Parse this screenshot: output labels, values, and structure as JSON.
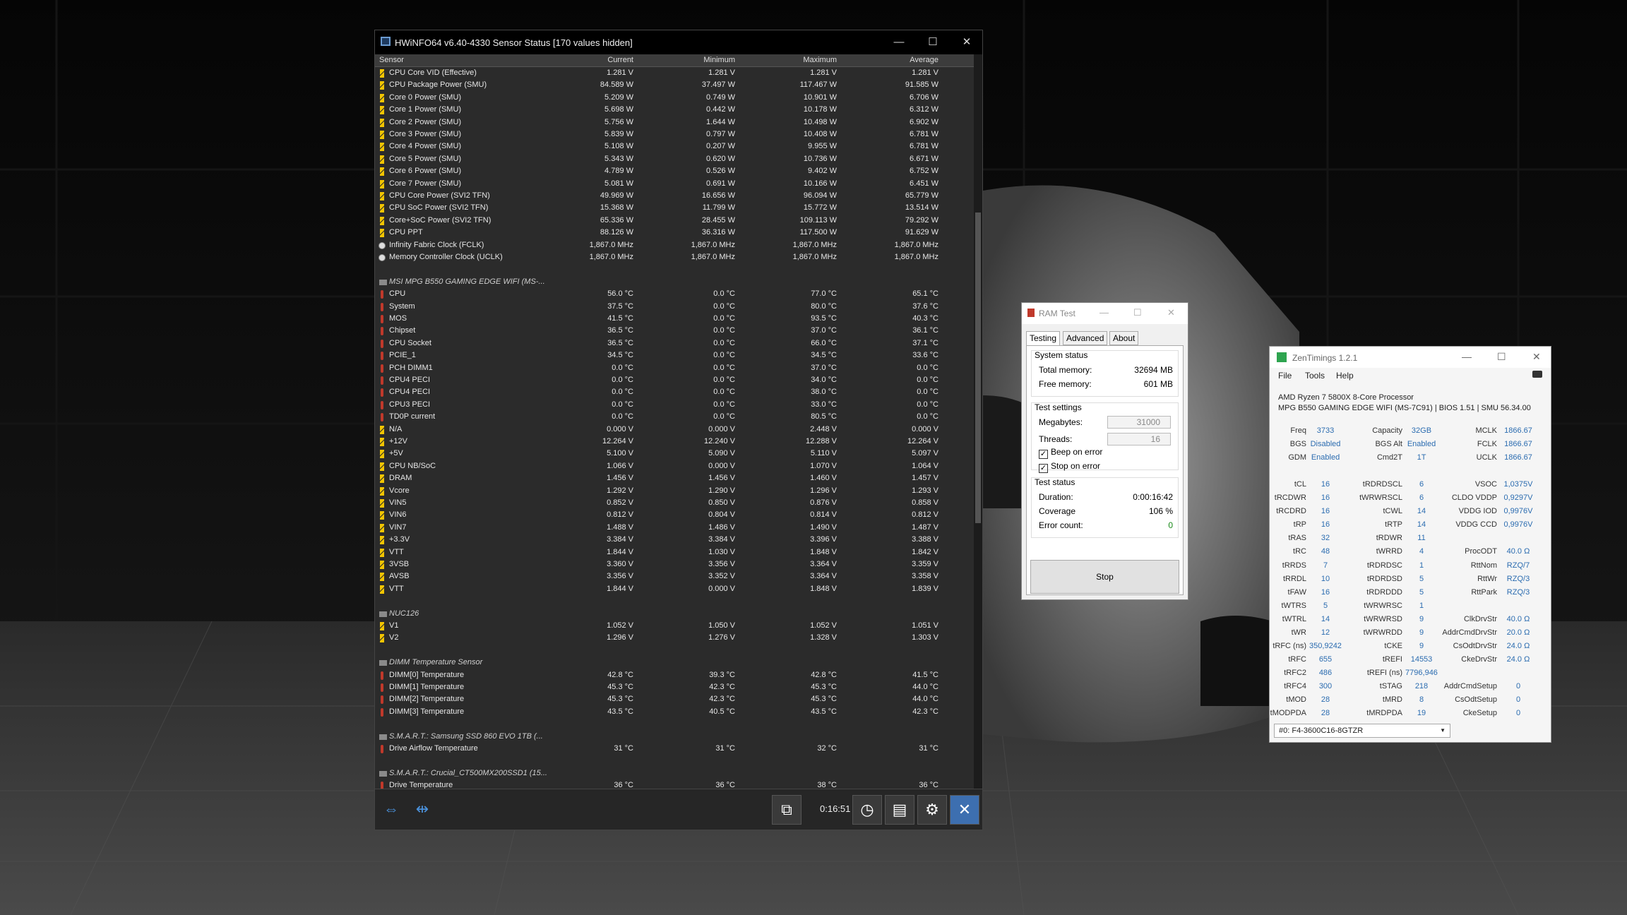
{
  "hwinfo": {
    "title": "HWiNFO64 v6.40-4330 Sensor Status [170 values hidden]",
    "columns": {
      "sensor": "Sensor",
      "current": "Current",
      "minimum": "Minimum",
      "maximum": "Maximum",
      "average": "Average"
    },
    "rows": [
      {
        "icon": "pw",
        "name": "CPU Core VID (Effective)",
        "cur": "1.281 V",
        "min": "1.281 V",
        "max": "1.281 V",
        "avg": "1.281 V"
      },
      {
        "icon": "pw",
        "name": "CPU Package Power (SMU)",
        "cur": "84.589 W",
        "min": "37.497 W",
        "max": "117.467 W",
        "avg": "91.585 W"
      },
      {
        "icon": "pw",
        "name": "Core 0 Power (SMU)",
        "cur": "5.209 W",
        "min": "0.749 W",
        "max": "10.901 W",
        "avg": "6.706 W"
      },
      {
        "icon": "pw",
        "name": "Core 1 Power (SMU)",
        "cur": "5.698 W",
        "min": "0.442 W",
        "max": "10.178 W",
        "avg": "6.312 W"
      },
      {
        "icon": "pw",
        "name": "Core 2 Power (SMU)",
        "cur": "5.756 W",
        "min": "1.644 W",
        "max": "10.498 W",
        "avg": "6.902 W"
      },
      {
        "icon": "pw",
        "name": "Core 3 Power (SMU)",
        "cur": "5.839 W",
        "min": "0.797 W",
        "max": "10.408 W",
        "avg": "6.781 W"
      },
      {
        "icon": "pw",
        "name": "Core 4 Power (SMU)",
        "cur": "5.108 W",
        "min": "0.207 W",
        "max": "9.955 W",
        "avg": "6.781 W"
      },
      {
        "icon": "pw",
        "name": "Core 5 Power (SMU)",
        "cur": "5.343 W",
        "min": "0.620 W",
        "max": "10.736 W",
        "avg": "6.671 W"
      },
      {
        "icon": "pw",
        "name": "Core 6 Power (SMU)",
        "cur": "4.789 W",
        "min": "0.526 W",
        "max": "9.402 W",
        "avg": "6.752 W"
      },
      {
        "icon": "pw",
        "name": "Core 7 Power (SMU)",
        "cur": "5.081 W",
        "min": "0.691 W",
        "max": "10.166 W",
        "avg": "6.451 W"
      },
      {
        "icon": "pw",
        "name": "CPU Core Power (SVI2 TFN)",
        "cur": "49.969 W",
        "min": "16.656 W",
        "max": "96.094 W",
        "avg": "65.779 W"
      },
      {
        "icon": "pw",
        "name": "CPU SoC Power (SVI2 TFN)",
        "cur": "15.368 W",
        "min": "11.799 W",
        "max": "15.772 W",
        "avg": "13.514 W"
      },
      {
        "icon": "pw",
        "name": "Core+SoC Power (SVI2 TFN)",
        "cur": "65.336 W",
        "min": "28.455 W",
        "max": "109.113 W",
        "avg": "79.292 W"
      },
      {
        "icon": "pw",
        "name": "CPU PPT",
        "cur": "88.126 W",
        "min": "36.316 W",
        "max": "117.500 W",
        "avg": "91.629 W"
      },
      {
        "icon": "ck",
        "name": "Infinity Fabric Clock (FCLK)",
        "cur": "1,867.0 MHz",
        "min": "1,867.0 MHz",
        "max": "1,867.0 MHz",
        "avg": "1,867.0 MHz"
      },
      {
        "icon": "ck",
        "name": "Memory Controller Clock (UCLK)",
        "cur": "1,867.0 MHz",
        "min": "1,867.0 MHz",
        "max": "1,867.0 MHz",
        "avg": "1,867.0 MHz"
      },
      {
        "blank": true
      },
      {
        "group": true,
        "name": "MSI MPG B550 GAMING EDGE WIFI (MS-..."
      },
      {
        "icon": "tp",
        "name": "CPU",
        "cur": "56.0 °C",
        "min": "0.0 °C",
        "max": "77.0 °C",
        "avg": "65.1 °C"
      },
      {
        "icon": "tp",
        "name": "System",
        "cur": "37.5 °C",
        "min": "0.0 °C",
        "max": "80.0 °C",
        "avg": "37.6 °C"
      },
      {
        "icon": "tp",
        "name": "MOS",
        "cur": "41.5 °C",
        "min": "0.0 °C",
        "max": "93.5 °C",
        "avg": "40.3 °C"
      },
      {
        "icon": "tp",
        "name": "Chipset",
        "cur": "36.5 °C",
        "min": "0.0 °C",
        "max": "37.0 °C",
        "avg": "36.1 °C"
      },
      {
        "icon": "tp",
        "name": "CPU Socket",
        "cur": "36.5 °C",
        "min": "0.0 °C",
        "max": "66.0 °C",
        "avg": "37.1 °C"
      },
      {
        "icon": "tp",
        "name": "PCIE_1",
        "cur": "34.5 °C",
        "min": "0.0 °C",
        "max": "34.5 °C",
        "avg": "33.6 °C"
      },
      {
        "icon": "tp",
        "name": "PCH DIMM1",
        "cur": "0.0 °C",
        "min": "0.0 °C",
        "max": "37.0 °C",
        "avg": "0.0 °C"
      },
      {
        "icon": "tp",
        "name": "CPU4 PECI",
        "cur": "0.0 °C",
        "min": "0.0 °C",
        "max": "34.0 °C",
        "avg": "0.0 °C"
      },
      {
        "icon": "tp",
        "name": "CPU4 PECI",
        "cur": "0.0 °C",
        "min": "0.0 °C",
        "max": "38.0 °C",
        "avg": "0.0 °C"
      },
      {
        "icon": "tp",
        "name": "CPU3 PECI",
        "cur": "0.0 °C",
        "min": "0.0 °C",
        "max": "33.0 °C",
        "avg": "0.0 °C"
      },
      {
        "icon": "tp",
        "name": "TD0P current",
        "cur": "0.0 °C",
        "min": "0.0 °C",
        "max": "80.5 °C",
        "avg": "0.0 °C"
      },
      {
        "icon": "vt",
        "name": "N/A",
        "cur": "0.000 V",
        "min": "0.000 V",
        "max": "2.448 V",
        "avg": "0.000 V"
      },
      {
        "icon": "vt",
        "name": "+12V",
        "cur": "12.264 V",
        "min": "12.240 V",
        "max": "12.288 V",
        "avg": "12.264 V"
      },
      {
        "icon": "vt",
        "name": "+5V",
        "cur": "5.100 V",
        "min": "5.090 V",
        "max": "5.110 V",
        "avg": "5.097 V"
      },
      {
        "icon": "vt",
        "name": "CPU NB/SoC",
        "cur": "1.066 V",
        "min": "0.000 V",
        "max": "1.070 V",
        "avg": "1.064 V"
      },
      {
        "icon": "vt",
        "name": "DRAM",
        "cur": "1.456 V",
        "min": "1.456 V",
        "max": "1.460 V",
        "avg": "1.457 V"
      },
      {
        "icon": "vt",
        "name": "Vcore",
        "cur": "1.292 V",
        "min": "1.290 V",
        "max": "1.296 V",
        "avg": "1.293 V"
      },
      {
        "icon": "vt",
        "name": "VIN5",
        "cur": "0.852 V",
        "min": "0.850 V",
        "max": "0.876 V",
        "avg": "0.858 V"
      },
      {
        "icon": "vt",
        "name": "VIN6",
        "cur": "0.812 V",
        "min": "0.804 V",
        "max": "0.814 V",
        "avg": "0.812 V"
      },
      {
        "icon": "vt",
        "name": "VIN7",
        "cur": "1.488 V",
        "min": "1.486 V",
        "max": "1.490 V",
        "avg": "1.487 V"
      },
      {
        "icon": "vt",
        "name": "+3.3V",
        "cur": "3.384 V",
        "min": "3.384 V",
        "max": "3.396 V",
        "avg": "3.388 V"
      },
      {
        "icon": "vt",
        "name": "VTT",
        "cur": "1.844 V",
        "min": "1.030 V",
        "max": "1.848 V",
        "avg": "1.842 V"
      },
      {
        "icon": "vt",
        "name": "3VSB",
        "cur": "3.360 V",
        "min": "3.356 V",
        "max": "3.364 V",
        "avg": "3.359 V"
      },
      {
        "icon": "vt",
        "name": "AVSB",
        "cur": "3.356 V",
        "min": "3.352 V",
        "max": "3.364 V",
        "avg": "3.358 V"
      },
      {
        "icon": "vt",
        "name": "VTT",
        "cur": "1.844 V",
        "min": "0.000 V",
        "max": "1.848 V",
        "avg": "1.839 V"
      },
      {
        "blank": true
      },
      {
        "group": true,
        "name": "NUC126"
      },
      {
        "icon": "vt",
        "name": "V1",
        "cur": "1.052 V",
        "min": "1.050 V",
        "max": "1.052 V",
        "avg": "1.051 V"
      },
      {
        "icon": "vt",
        "name": "V2",
        "cur": "1.296 V",
        "min": "1.276 V",
        "max": "1.328 V",
        "avg": "1.303 V"
      },
      {
        "blank": true
      },
      {
        "group": true,
        "name": "DIMM Temperature Sensor"
      },
      {
        "icon": "tp",
        "name": "DIMM[0] Temperature",
        "cur": "42.8 °C",
        "min": "39.3 °C",
        "max": "42.8 °C",
        "avg": "41.5 °C"
      },
      {
        "icon": "tp",
        "name": "DIMM[1] Temperature",
        "cur": "45.3 °C",
        "min": "42.3 °C",
        "max": "45.3 °C",
        "avg": "44.0 °C"
      },
      {
        "icon": "tp",
        "name": "DIMM[2] Temperature",
        "cur": "45.3 °C",
        "min": "42.3 °C",
        "max": "45.3 °C",
        "avg": "44.0 °C"
      },
      {
        "icon": "tp",
        "name": "DIMM[3] Temperature",
        "cur": "43.5 °C",
        "min": "40.5 °C",
        "max": "43.5 °C",
        "avg": "42.3 °C"
      },
      {
        "blank": true
      },
      {
        "group": true,
        "name": "S.M.A.R.T.: Samsung SSD 860 EVO 1TB (..."
      },
      {
        "icon": "tp",
        "name": "Drive Airflow Temperature",
        "cur": "31 °C",
        "min": "31 °C",
        "max": "32 °C",
        "avg": "31 °C"
      },
      {
        "blank": true
      },
      {
        "group": true,
        "name": "S.M.A.R.T.: Crucial_CT500MX200SSD1 (15..."
      },
      {
        "icon": "tp",
        "name": "Drive Temperature",
        "cur": "36 °C",
        "min": "36 °C",
        "max": "38 °C",
        "avg": "36 °C"
      }
    ],
    "timer": "0:16:51"
  },
  "ramtest": {
    "title": "RAM Test",
    "tabs": [
      "Testing",
      "Advanced",
      "About"
    ],
    "system_status": {
      "legend": "System status",
      "total_label": "Total memory:",
      "total_value": "32694 MB",
      "free_label": "Free memory:",
      "free_value": "601 MB"
    },
    "test_settings": {
      "legend": "Test settings",
      "mb_label": "Megabytes:",
      "mb_value": "31000",
      "threads_label": "Threads:",
      "threads_value": "16",
      "beep_label": "Beep on error",
      "stop_label": "Stop on error"
    },
    "test_status": {
      "legend": "Test status",
      "duration_label": "Duration:",
      "duration_value": "0:00:16:42",
      "coverage_label": "Coverage",
      "coverage_value": "106 %",
      "errors_label": "Error count:",
      "errors_value": "0"
    },
    "stop_label": "Stop"
  },
  "zentimings": {
    "title": "ZenTimings 1.2.1",
    "menu": [
      "File",
      "Tools",
      "Help"
    ],
    "cpu": "AMD Ryzen 7 5800X 8-Core Processor",
    "board": "MPG B550 GAMING EDGE WIFI (MS-7C91) | BIOS 1.51 | SMU 56.34.00",
    "left": [
      [
        "Freq",
        "3733"
      ],
      [
        "BGS",
        "Disabled"
      ],
      [
        "GDM",
        "Enabled"
      ],
      null,
      [
        "tCL",
        "16"
      ],
      [
        "tRCDWR",
        "16"
      ],
      [
        "tRCDRD",
        "16"
      ],
      [
        "tRP",
        "16"
      ],
      [
        "tRAS",
        "32"
      ],
      [
        "tRC",
        "48"
      ],
      [
        "tRRDS",
        "7"
      ],
      [
        "tRRDL",
        "10"
      ],
      [
        "tFAW",
        "16"
      ],
      [
        "tWTRS",
        "5"
      ],
      [
        "tWTRL",
        "14"
      ],
      [
        "tWR",
        "12"
      ],
      [
        "tRFC (ns)",
        "350,9242"
      ],
      [
        "tRFC",
        "655"
      ],
      [
        "tRFC2",
        "486"
      ],
      [
        "tRFC4",
        "300"
      ],
      [
        "tMOD",
        "28"
      ],
      [
        "tMODPDA",
        "28"
      ]
    ],
    "mid": [
      [
        "Capacity",
        "32GB"
      ],
      [
        "BGS Alt",
        "Enabled"
      ],
      [
        "Cmd2T",
        "1T"
      ],
      null,
      [
        "tRDRDSCL",
        "6"
      ],
      [
        "tWRWRSCL",
        "6"
      ],
      [
        "tCWL",
        "14"
      ],
      [
        "tRTP",
        "14"
      ],
      [
        "tRDWR",
        "11"
      ],
      [
        "tWRRD",
        "4"
      ],
      [
        "tRDRDSC",
        "1"
      ],
      [
        "tRDRDSD",
        "5"
      ],
      [
        "tRDRDDD",
        "5"
      ],
      [
        "tWRWRSC",
        "1"
      ],
      [
        "tWRWRSD",
        "9"
      ],
      [
        "tWRWRDD",
        "9"
      ],
      [
        "tCKE",
        "9"
      ],
      [
        "tREFI",
        "14553"
      ],
      [
        "tREFI (ns)",
        "7796,946"
      ],
      [
        "tSTAG",
        "218"
      ],
      [
        "tMRD",
        "8"
      ],
      [
        "tMRDPDA",
        "19"
      ]
    ],
    "right": [
      [
        "MCLK",
        "1866.67"
      ],
      [
        "FCLK",
        "1866.67"
      ],
      [
        "UCLK",
        "1866.67"
      ],
      null,
      [
        "VSOC",
        "1,0375V"
      ],
      [
        "CLDO VDDP",
        "0,9297V"
      ],
      [
        "VDDG IOD",
        "0,9976V"
      ],
      [
        "VDDG CCD",
        "0,9976V"
      ],
      null,
      [
        "ProcODT",
        "40.0 Ω"
      ],
      [
        "RttNom",
        "RZQ/7"
      ],
      [
        "RttWr",
        "RZQ/3"
      ],
      [
        "RttPark",
        "RZQ/3"
      ],
      null,
      [
        "ClkDrvStr",
        "40.0 Ω"
      ],
      [
        "AddrCmdDrvStr",
        "20.0 Ω"
      ],
      [
        "CsOdtDrvStr",
        "24.0 Ω"
      ],
      [
        "CkeDrvStr",
        "24.0 Ω"
      ],
      null,
      [
        "AddrCmdSetup",
        "0"
      ],
      [
        "CsOdtSetup",
        "0"
      ],
      [
        "CkeSetup",
        "0"
      ]
    ],
    "module": "#0: F4-3600C16-8GTZR"
  }
}
